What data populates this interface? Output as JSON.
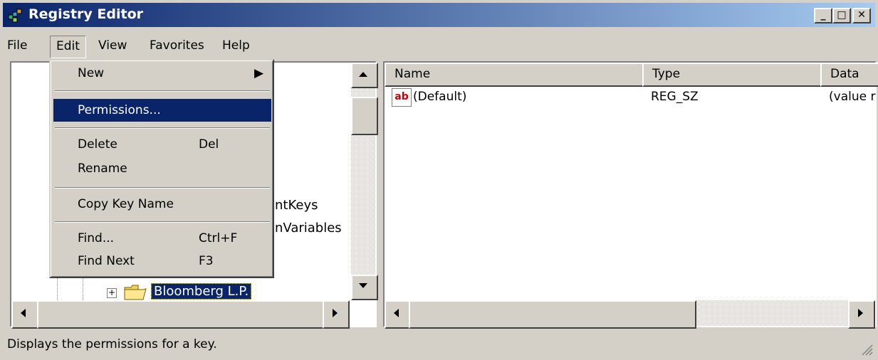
{
  "window": {
    "title": "Registry Editor"
  },
  "caption_buttons": {
    "minimize": "_",
    "maximize": "□",
    "close": "✕"
  },
  "menubar": [
    "File",
    "Edit",
    "View",
    "Favorites",
    "Help"
  ],
  "edit_menu": {
    "new": "New",
    "permissions": "Permissions...",
    "delete": "Delete",
    "delete_shortcut": "Del",
    "rename": "Rename",
    "copy_key_name": "Copy Key Name",
    "find": "Find...",
    "find_shortcut": "Ctrl+F",
    "find_next": "Find Next",
    "find_next_shortcut": "F3"
  },
  "tree": {
    "partial_1": "ntKeys",
    "partial_2": "nVariables",
    "selected_key": "Bloomberg L.P.",
    "expander": "+"
  },
  "list": {
    "columns": [
      "Name",
      "Type",
      "Data"
    ],
    "rows": [
      {
        "name": "(Default)",
        "type": "REG_SZ",
        "data": "(value r"
      }
    ],
    "icon_text": "ab"
  },
  "statusbar": {
    "text": "Displays the permissions for a key."
  }
}
